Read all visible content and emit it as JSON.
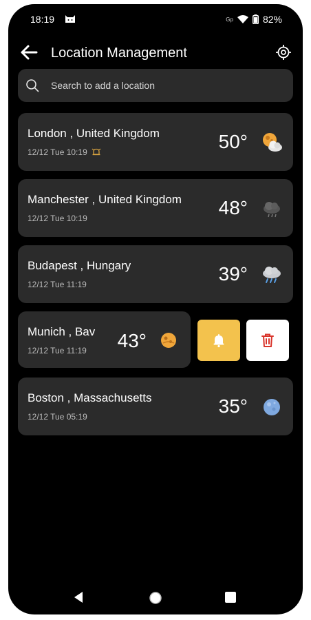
{
  "status_bar": {
    "time": "18:19",
    "battery_pct": "82%",
    "sim_label": "Gp"
  },
  "header": {
    "title": "Location Management"
  },
  "search": {
    "placeholder": "Search to add a location"
  },
  "locations": [
    {
      "city": "London , United Kingdom",
      "datetime": "12/12 Tue 10:19",
      "temp": "50°",
      "icon": "partly-cloudy-icon",
      "alert": true
    },
    {
      "city": "Manchester , United Kingdom",
      "datetime": "12/12 Tue 10:19",
      "temp": "48°",
      "icon": "cloud-rain-icon",
      "alert": false
    },
    {
      "city": "Budapest , Hungary",
      "datetime": "12/12 Tue 11:19",
      "temp": "39°",
      "icon": "rain-icon",
      "alert": false
    },
    {
      "city": "Munich , Bav",
      "datetime": "12/12 Tue 11:19",
      "temp": "43°",
      "icon": "hazy-sun-icon",
      "alert": false
    },
    {
      "city": "Boston , Massachusetts",
      "datetime": "12/12 Tue 05:19",
      "temp": "35°",
      "icon": "moon-icon",
      "alert": false
    }
  ],
  "colors": {
    "background": "#000000",
    "card": "#2b2b2b",
    "alert_button": "#f3c24d",
    "delete_icon": "#d9342b",
    "alert_accent": "#d9a441"
  }
}
